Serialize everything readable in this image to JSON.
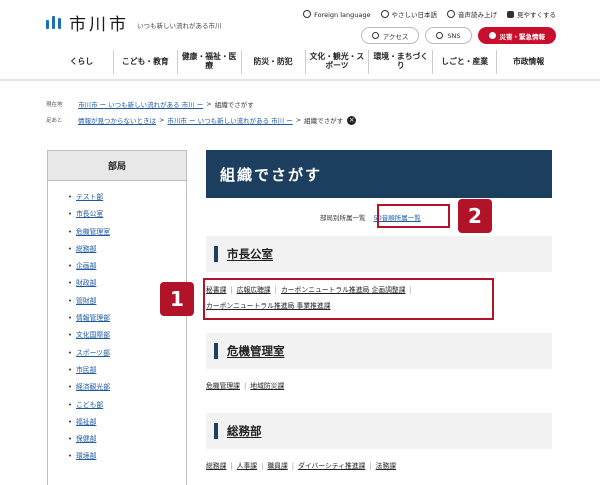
{
  "header": {
    "logo_name": "市川市",
    "tagline": "いつも新しい流れがある市川",
    "utility": [
      "Foreign language",
      "やさしい日本語",
      "音声読み上げ",
      "見やすくする"
    ],
    "pills": [
      "アクセス",
      "SNS",
      "災害・緊急情報"
    ],
    "nav": [
      "くらし",
      "こども・教育",
      "健康・福祉・医療",
      "防災・防犯",
      "文化・観光・スポーツ",
      "環境・まちづくり",
      "しごと・産業",
      "市政情報"
    ]
  },
  "breadcrumbs": {
    "current_label": "現在地",
    "current_home": "市川市 ー いつも新しい流れがある 市川 ー",
    "current_sep": ">",
    "current_page": "組織でさがす",
    "trail_label": "足あと",
    "trail_link1": "情報が見つからないときは",
    "trail_link2": "市川市 ー いつも新しい流れがある 市川 ー",
    "trail_page": "組織でさがす"
  },
  "sidebar": {
    "title": "部局",
    "items": [
      "テスト部",
      "市長公室",
      "危機管理室",
      "総務部",
      "企画部",
      "財政部",
      "管財部",
      "情報管理部",
      "文化国際部",
      "スポーツ部",
      "市民部",
      "経済観光部",
      "こども部",
      "福祉部",
      "保健部",
      "環境部"
    ]
  },
  "main": {
    "title": "組織でさがす",
    "switch_current": "部局別所属一覧",
    "switch_link": "50音順所属一覧",
    "sections": [
      {
        "name": "市長公室",
        "links": [
          "秘書課",
          "広報広聴課",
          "カーボンニュートラル推進局 企画調整課",
          "カーボンニュートラル推進局 事業推進課"
        ]
      },
      {
        "name": "危機管理室",
        "links": [
          "危機管理課",
          "地域防災課"
        ]
      },
      {
        "name": "総務部",
        "links": [
          "総務課",
          "人事課",
          "職員課",
          "ダイバーシティ推進課",
          "法務課"
        ]
      }
    ]
  },
  "annotations": {
    "badge1": "1",
    "badge2": "2"
  },
  "colors": {
    "accent": "#1d3f5f",
    "link": "#1d5aa6",
    "alert": "#c8102e",
    "annotation": "#b31329"
  }
}
